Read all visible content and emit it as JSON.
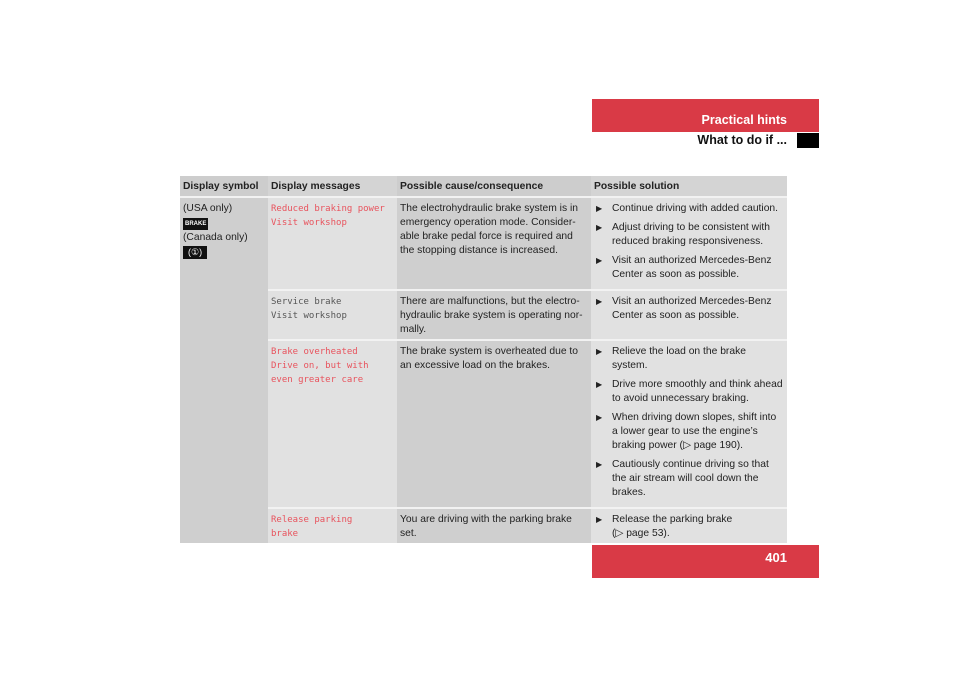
{
  "header": {
    "section": "Practical hints",
    "subsection": "What to do if ..."
  },
  "page_number": "401",
  "table": {
    "columns": [
      "Display symbol",
      "Display messages",
      "Possible cause/consequence",
      "Possible solution"
    ],
    "symbol": {
      "usa_label": "(USA only)",
      "usa_icon": "BRAKE",
      "canada_label": "(Canada only)",
      "canada_icon": "(①)"
    },
    "rows": [
      {
        "message": "Reduced braking power\nVisit workshop",
        "message_color": "red",
        "cause": "The electrohydraulic brake system is in emergency operation mode. Consider-able brake pedal force is required and the stopping distance is increased.",
        "solutions": [
          "Continue driving with added caution.",
          "Adjust driving to be consistent with reduced braking responsiveness.",
          "Visit an authorized Mercedes-Benz Center as soon as possible."
        ]
      },
      {
        "message": "Service brake\nVisit workshop",
        "message_color": "gray",
        "cause": "There are malfunctions, but the electro-hydraulic brake system is operating nor-mally.",
        "solutions": [
          "Visit an authorized Mercedes-Benz Center as soon as possible."
        ]
      },
      {
        "message": "Brake overheated\nDrive on, but with\neven greater care",
        "message_color": "red",
        "cause": "The brake system is overheated due to an excessive load on the brakes.",
        "solutions": [
          "Relieve the load on the brake system.",
          "Drive more smoothly and think ahead to avoid unnecessary braking.",
          "When driving down slopes, shift into a lower gear to use the engine’s braking power (▷ page 190).",
          "Cautiously continue driving so that the air stream will cool down the brakes."
        ]
      },
      {
        "message": "Release parking\nbrake",
        "message_color": "red",
        "cause": "You are driving with the parking brake set.",
        "solutions": [
          "Release the parking brake\n(▷ page 53)."
        ]
      }
    ]
  },
  "colors": {
    "accent": "#d93a46",
    "message_red": "#e8535d"
  }
}
